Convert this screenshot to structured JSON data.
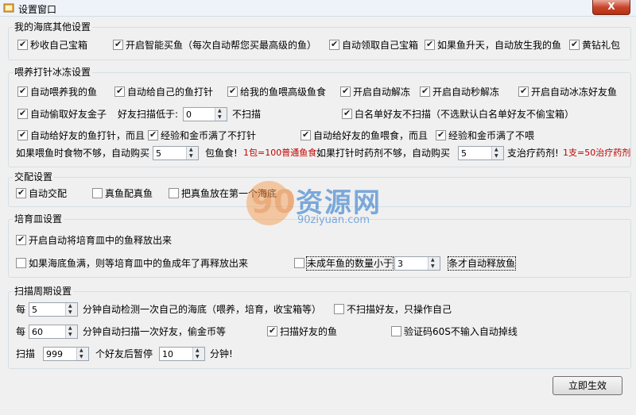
{
  "window": {
    "title": "设置窗口",
    "close_label": "X"
  },
  "groups": {
    "other": {
      "title": "我的海底其他设置",
      "items": [
        {
          "label": "秒收自己宝箱",
          "checked": true
        },
        {
          "label": "开启智能买鱼（每次自动帮您买最高级的鱼）",
          "checked": true
        },
        {
          "label": "自动领取自己宝箱",
          "checked": true
        },
        {
          "label": "如果鱼升天，自动放生我的鱼",
          "checked": true
        },
        {
          "label": "黄钻礼包",
          "checked": true
        }
      ]
    },
    "feed": {
      "title": "喂养打针冰冻设置",
      "row1": [
        {
          "label": "自动喂养我的鱼",
          "checked": true
        },
        {
          "label": "自动给自己的鱼打针",
          "checked": true
        },
        {
          "label": "给我的鱼喂高级鱼食",
          "checked": true
        },
        {
          "label": "开启自动解冻",
          "checked": true
        },
        {
          "label": "开启自动秒解冻",
          "checked": true
        },
        {
          "label": "开启自动冰冻好友鱼",
          "checked": true
        }
      ],
      "steal": {
        "label": "自动偷取好友金子",
        "checked": true
      },
      "low_label": "好友扫描低于:",
      "low_value": "0",
      "no_scan": "不扫描",
      "whitelist": {
        "label": "白名单好友不扫描（不选默认白名单好友不偷宝箱）",
        "checked": true
      },
      "inject_friend": {
        "label": "自动给好友的鱼打针，而且",
        "checked": true
      },
      "exp_full_1": {
        "label": "经验和金币满了不打针",
        "checked": true
      },
      "feed_friend": {
        "label": "自动给好友的鱼喂食，而且",
        "checked": true
      },
      "exp_full_2": {
        "label": "经验和金币满了不喂",
        "checked": true
      },
      "food_prefix": "如果喂鱼时食物不够，自动购买",
      "food_value": "5",
      "food_suffix": "包鱼食!",
      "food_note": "1包=100普通鱼食",
      "med_prefix": "如果打针时药剂不够，自动购买",
      "med_value": "5",
      "med_suffix": "支治疗药剂!",
      "med_note": "1支=50治疗药剂"
    },
    "mate": {
      "title": "交配设置",
      "items": [
        {
          "label": "自动交配",
          "checked": true
        },
        {
          "label": "真鱼配真鱼",
          "checked": false
        },
        {
          "label": "把真鱼放在第一个海底",
          "checked": false
        }
      ]
    },
    "dish": {
      "title": "培育皿设置",
      "release": {
        "label": "开启自动将培育皿中的鱼释放出来",
        "checked": true
      },
      "full": {
        "label": "如果海底鱼满，则等培育皿中的鱼成年了再释放出来",
        "checked": false
      },
      "minor": {
        "label": "未成年鱼的数量小于",
        "checked": false
      },
      "minor_value": "3",
      "minor_suffix": "条才自动释放鱼"
    },
    "scan": {
      "title": "扫描周期设置",
      "r1_prefix": "每",
      "r1_value": "5",
      "r1_suffix": "分钟自动检测一次自己的海底（喂养，培育，收宝箱等）",
      "r1_check": {
        "label": "不扫描好友，只操作自己",
        "checked": false
      },
      "r2_prefix": "每",
      "r2_value": "60",
      "r2_suffix": "分钟自动扫描一次好友，偷金币等",
      "r2_check1": {
        "label": "扫描好友的鱼",
        "checked": true
      },
      "r2_check2": {
        "label": "验证码60S不输入自动掉线",
        "checked": false
      },
      "r3_prefix": "扫描",
      "r3_value": "999",
      "r3_mid": "个好友后暂停",
      "r3_value2": "10",
      "r3_suffix": "分钟!"
    }
  },
  "apply_label": "立即生效",
  "watermark": {
    "num": "90",
    "text": "资源网",
    "url": "90ziyuan.com"
  },
  "colors": {
    "note_red": "#c00000",
    "close_red": "#c9462c",
    "wm_blue": "#1a6fc9",
    "wm_orange": "#e87722"
  }
}
